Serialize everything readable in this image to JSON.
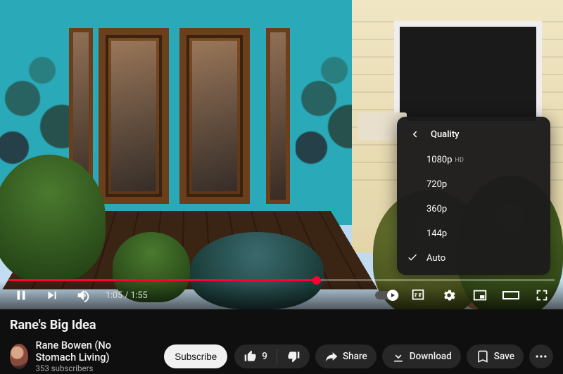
{
  "player": {
    "current_time": "1:05",
    "duration": "1:55",
    "progress_pct": 56.5
  },
  "quality_menu": {
    "title": "Quality",
    "options": [
      {
        "label": "1080p",
        "badge": "HD",
        "selected": false
      },
      {
        "label": "720p",
        "badge": "",
        "selected": false
      },
      {
        "label": "360p",
        "badge": "",
        "selected": false
      },
      {
        "label": "144p",
        "badge": "",
        "selected": false
      },
      {
        "label": "Auto",
        "badge": "",
        "selected": true
      }
    ]
  },
  "video": {
    "title": "Rane's Big Idea"
  },
  "channel": {
    "name": "Rane Bowen (No Stomach Living)",
    "subscribers": "353 subscribers",
    "subscribe_label": "Subscribe"
  },
  "actions": {
    "like_count": "9",
    "share_label": "Share",
    "download_label": "Download",
    "save_label": "Save"
  }
}
